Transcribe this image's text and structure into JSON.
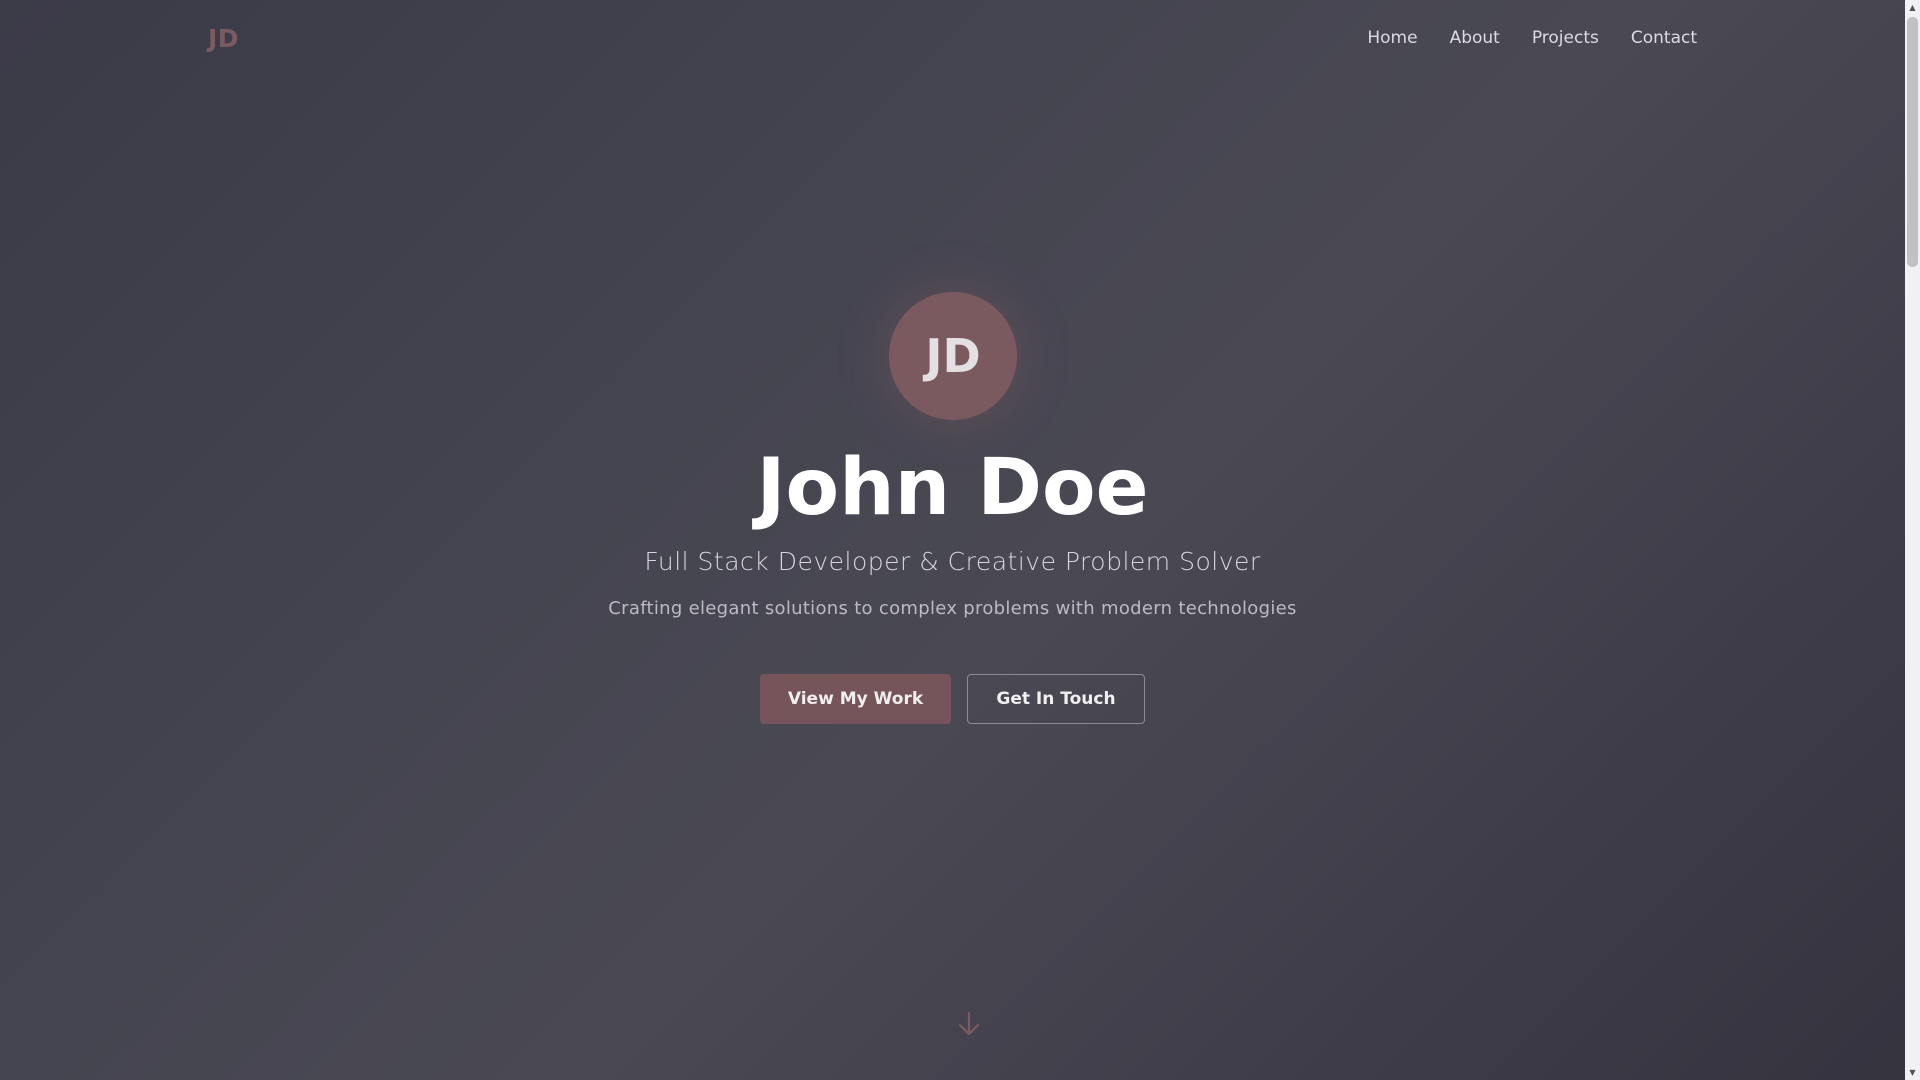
{
  "nav": {
    "logo": "JD",
    "links": [
      "Home",
      "About",
      "Projects",
      "Contact"
    ]
  },
  "hero": {
    "avatar_initials": "JD",
    "name": "John Doe",
    "tagline": "Full Stack Developer & Creative Problem Solver",
    "subtitle": "Crafting elegant solutions to complex problems with modern technologies",
    "primary_button": "View My Work",
    "secondary_button": "Get In Touch",
    "scroll_icon": "arrow-down-icon"
  },
  "colors": {
    "accent": "#755559",
    "logo": "#7a5c60",
    "background": "#43424d"
  }
}
